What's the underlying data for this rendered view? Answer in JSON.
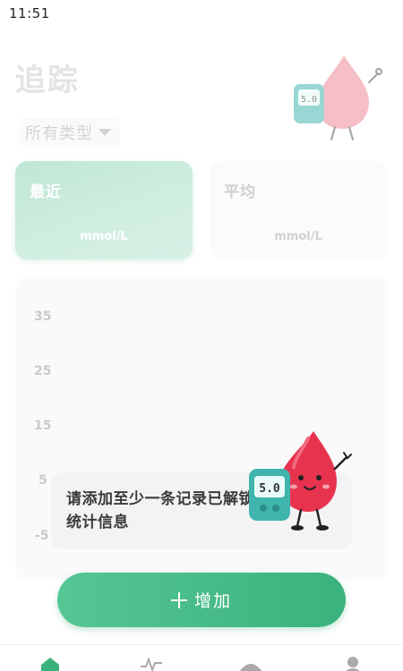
{
  "status_bar": {
    "time": "11:51"
  },
  "header": {
    "title": "追踪"
  },
  "filter": {
    "label": "所有类型"
  },
  "stats": {
    "recent": {
      "title": "最近",
      "unit": "mmol/L"
    },
    "average": {
      "title": "平均",
      "unit": "mmol/L"
    }
  },
  "chart": {
    "y_ticks": [
      "35",
      "25",
      "15",
      "5",
      "-5"
    ]
  },
  "empty_state": {
    "message": "请添加至少一条记录已解锁统计信息"
  },
  "mascot": {
    "meter_reading": "5.0"
  },
  "add_button": {
    "label": "增加"
  },
  "bottom_nav": {
    "items": [
      "home-icon",
      "heart-rate-icon",
      "stats-icon",
      "profile-icon"
    ]
  },
  "colors": {
    "accent": "#3bb27c",
    "accent_light": "#cfeee0",
    "blood": "#e8334f"
  }
}
